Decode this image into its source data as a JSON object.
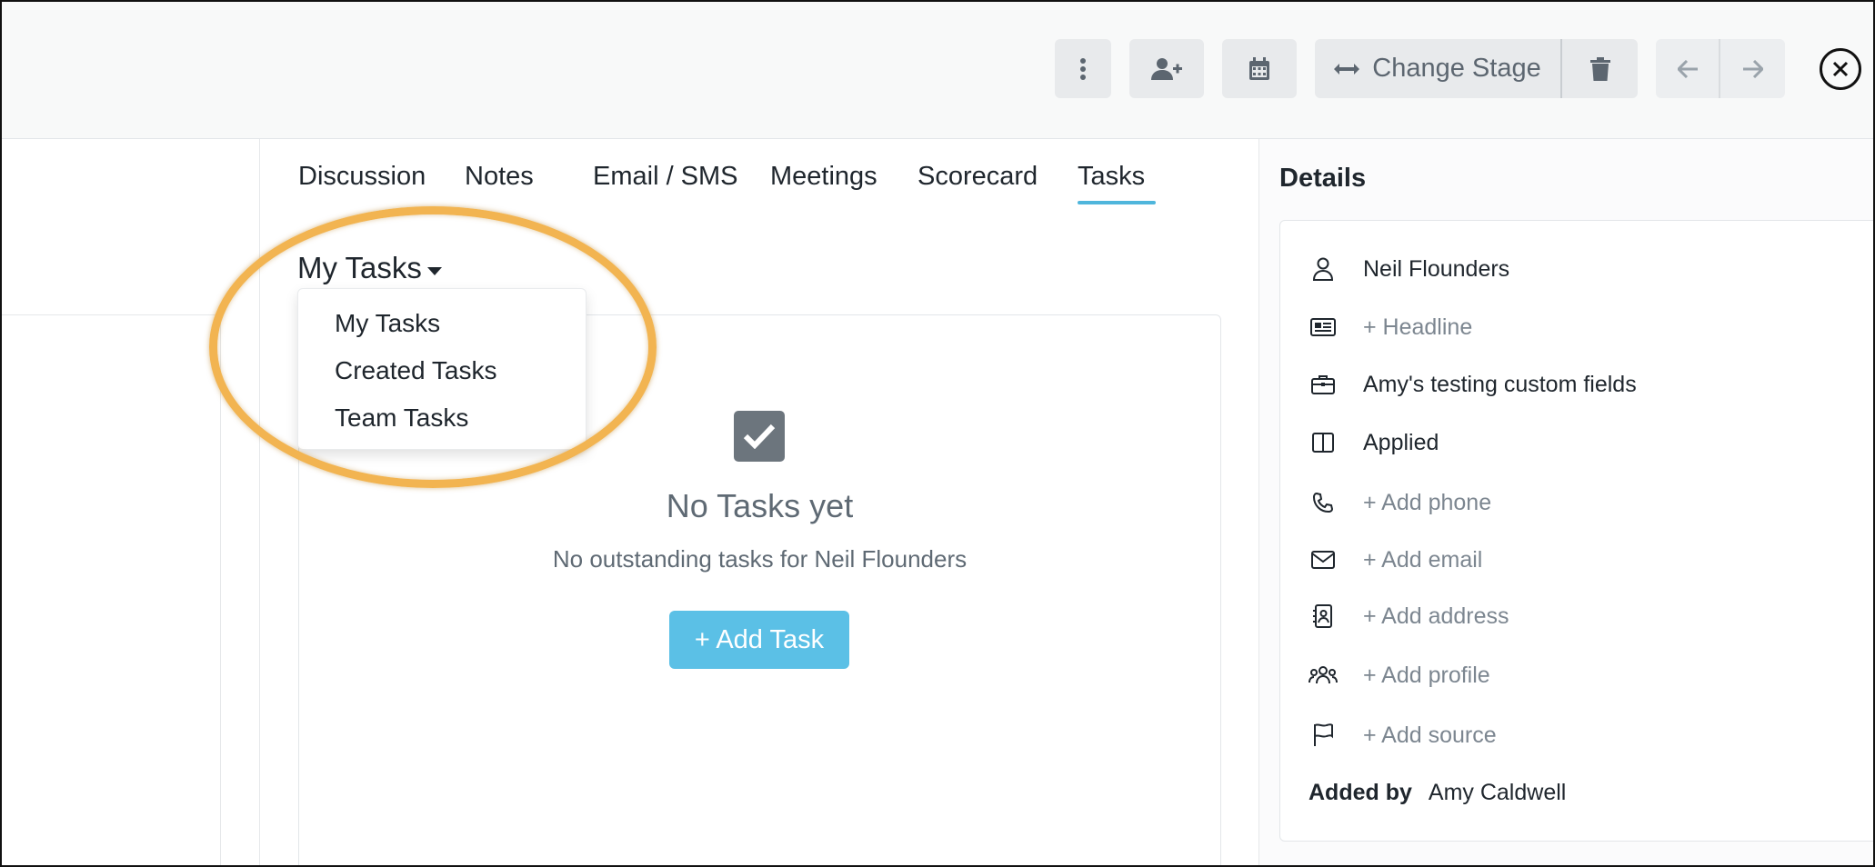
{
  "toolbar": {
    "change_stage_label": "Change Stage"
  },
  "tabs": [
    {
      "label": "Discussion"
    },
    {
      "label": "Notes"
    },
    {
      "label": "Email / SMS"
    },
    {
      "label": "Meetings"
    },
    {
      "label": "Scorecard"
    },
    {
      "label": "Tasks",
      "active": true
    }
  ],
  "tasks": {
    "filter_label": "My Tasks",
    "filter_options": [
      "My Tasks",
      "Created Tasks",
      "Team Tasks"
    ],
    "empty_title": "No Tasks yet",
    "empty_subtitle": "No outstanding tasks for Neil Flounders",
    "add_button_label": "+ Add Task"
  },
  "details": {
    "title": "Details",
    "rows": [
      {
        "icon": "user-icon",
        "text": "Neil Flounders",
        "muted": false
      },
      {
        "icon": "newspaper-icon",
        "text": "+ Headline",
        "muted": true
      },
      {
        "icon": "briefcase-icon",
        "text": "Amy's testing custom fields",
        "muted": false
      },
      {
        "icon": "columns-icon",
        "text": "Applied",
        "muted": false
      },
      {
        "icon": "phone-icon",
        "text": "+ Add phone",
        "muted": true
      },
      {
        "icon": "envelope-icon",
        "text": "+ Add email",
        "muted": true
      },
      {
        "icon": "address-book-icon",
        "text": "+ Add address",
        "muted": true
      },
      {
        "icon": "users-icon",
        "text": "+ Add profile",
        "muted": true
      },
      {
        "icon": "flag-icon",
        "text": "+ Add source",
        "muted": true
      }
    ],
    "added_by_label": "Added by",
    "added_by_value": "Amy Caldwell"
  },
  "colors": {
    "accent": "#5bc0e6",
    "highlight": "#f2b451",
    "muted_text": "#7c8690"
  }
}
